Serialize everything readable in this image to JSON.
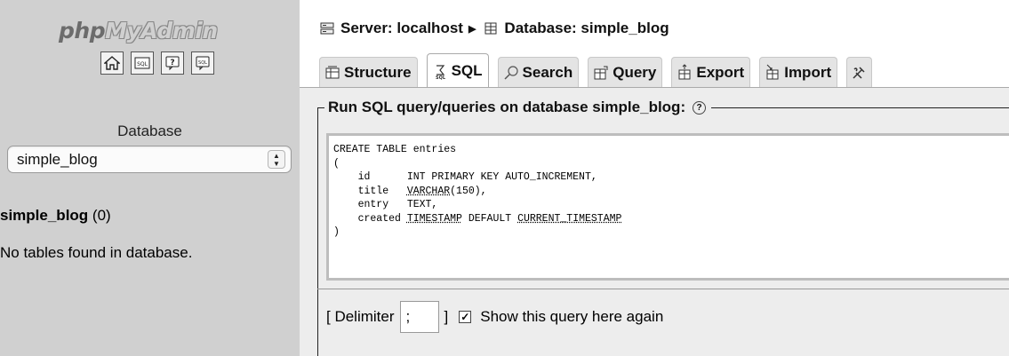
{
  "sidebar": {
    "logo_php": "php",
    "logo_myadmin": "MyAdmin",
    "icons": [
      "home-icon",
      "sql-query-icon",
      "help-icon",
      "sql-docs-icon"
    ],
    "database_label": "Database",
    "database_select": "simple_blog",
    "db_name": "simple_blog",
    "db_count": "(0)",
    "no_tables": "No tables found in database."
  },
  "breadcrumb": {
    "server": "Server: localhost",
    "database": "Database: simple_blog"
  },
  "tabs": [
    {
      "label": "Structure",
      "icon": "structure-icon"
    },
    {
      "label": "SQL",
      "icon": "sql-icon"
    },
    {
      "label": "Search",
      "icon": "search-icon"
    },
    {
      "label": "Query",
      "icon": "query-icon"
    },
    {
      "label": "Export",
      "icon": "export-icon"
    },
    {
      "label": "Import",
      "icon": "import-icon"
    }
  ],
  "active_tab": "SQL",
  "sql_panel": {
    "legend": "Run SQL query/queries on database simple_blog:",
    "query_lines": [
      "CREATE TABLE entries",
      "(",
      "    id      INT PRIMARY KEY AUTO_INCREMENT,",
      "    title   VARCHAR(150),",
      "    entry   TEXT,",
      "    created TIMESTAMP DEFAULT CURRENT_TIMESTAMP",
      ")"
    ],
    "delimiter_open": "[ Delimiter",
    "delimiter_value": ";",
    "delimiter_close": "]",
    "show_query_label": "Show this query here again",
    "show_query_checked": true
  }
}
